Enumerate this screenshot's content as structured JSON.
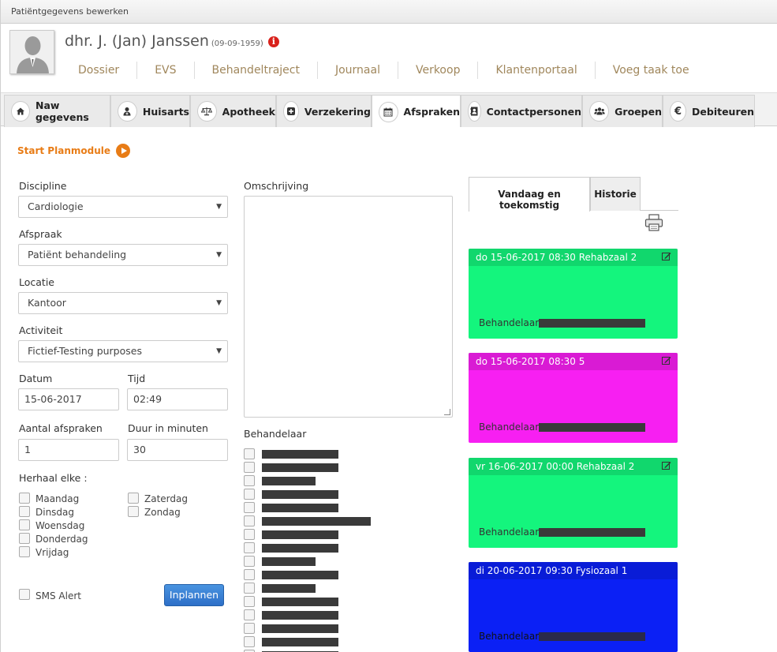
{
  "window": {
    "title": "Patiëntgegevens bewerken"
  },
  "patient": {
    "name": "dhr. J. (Jan) Janssen",
    "dob": "(09-09-1959)"
  },
  "topnav": [
    "Dossier",
    "EVS",
    "Behandeltraject",
    "Journaal",
    "Verkoop",
    "Klantenportaal",
    "Voeg taak toe"
  ],
  "tabs": [
    {
      "label": "Naw gegevens",
      "icon": "home-icon"
    },
    {
      "label": "Huisarts",
      "icon": "doctor-icon"
    },
    {
      "label": "Apotheek",
      "icon": "scale-icon"
    },
    {
      "label": "Verzekering",
      "icon": "plus-square-icon"
    },
    {
      "label": "Afspraken",
      "icon": "calendar-icon"
    },
    {
      "label": "Contactpersonen",
      "icon": "address-book-icon"
    },
    {
      "label": "Groepen",
      "icon": "group-icon"
    },
    {
      "label": "Debiteuren",
      "icon": "euro-icon"
    }
  ],
  "active_tab": "Afspraken",
  "plan_link": "Start Planmodule",
  "form": {
    "discipline_label": "Discipline",
    "discipline_value": "Cardiologie",
    "afspraak_label": "Afspraak",
    "afspraak_value": "Patiënt behandeling",
    "locatie_label": "Locatie",
    "locatie_value": "Kantoor",
    "activiteit_label": "Activiteit",
    "activiteit_value": "Fictief-Testing purposes",
    "datum_label": "Datum",
    "datum_value": "15-06-2017",
    "tijd_label": "Tijd",
    "tijd_value": "02:49",
    "aantal_label": "Aantal afspraken",
    "aantal_value": "1",
    "duur_label": "Duur in minuten",
    "duur_value": "30",
    "herhaal_label": "Herhaal elke :",
    "days_left": [
      "Maandag",
      "Dinsdag",
      "Woensdag",
      "Donderdag",
      "Vrijdag"
    ],
    "days_right": [
      "Zaterdag",
      "Zondag"
    ],
    "sms_label": "SMS Alert",
    "submit_label": "Inplannen",
    "omschrijving_label": "Omschrijving",
    "behandelaar_label": "Behandelaar"
  },
  "right": {
    "tab_today": "Vandaag en toekomstig",
    "tab_history": "Historie",
    "card_label": "Behandelaar:",
    "appointments": [
      {
        "header": "do 15-06-2017 08:30 Rehabzaal 2",
        "color": "#14f57d"
      },
      {
        "header": "do 15-06-2017 08:30 5",
        "color": "#f71ff2"
      },
      {
        "header": "vr 16-06-2017 00:00 Rehabzaal 2",
        "color": "#14f57d"
      },
      {
        "header": "di 20-06-2017 09:30 Fysiozaal 1",
        "color": "#0b20f5"
      }
    ]
  }
}
